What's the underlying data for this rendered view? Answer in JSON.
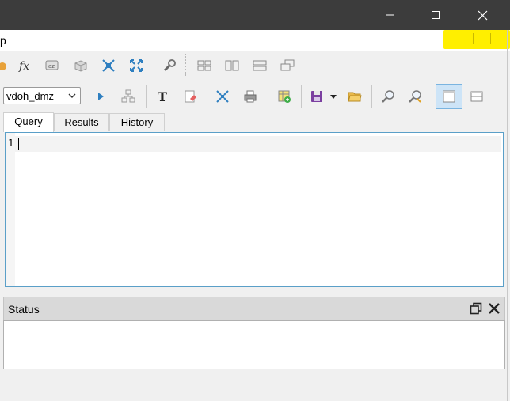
{
  "window": {
    "controls": {
      "minimize": "minimize-icon",
      "maximize": "maximize-icon",
      "close": "close-icon"
    }
  },
  "menubar": {
    "partial_label": "p"
  },
  "toolbar_top": {
    "icons": [
      "star-icon",
      "function-icon",
      "sort-icon",
      "table-icon",
      "collapse-icon",
      "expand-icon",
      "wrench-icon",
      "tile-grid-icon",
      "tile-vertical-icon",
      "tile-horizontal-icon",
      "cascade-icon"
    ]
  },
  "toolbar_query": {
    "database": "vdoh_dmz",
    "icons": [
      "execute-icon",
      "explain-icon",
      "text-format-icon",
      "eraser-icon",
      "expand-all-icon",
      "print-icon",
      "add-table-icon",
      "save-icon",
      "dropdown-arrow-icon",
      "open-folder-icon",
      "find-icon",
      "find-next-icon",
      "split-vertical-icon",
      "split-horizontal-icon"
    ]
  },
  "tabs": [
    "Query",
    "Results",
    "History"
  ],
  "active_tab": "Query",
  "editor": {
    "line_numbers": [
      "1"
    ]
  },
  "status_panel": {
    "title": "Status",
    "icons": [
      "restore-icon",
      "close-panel-icon"
    ]
  },
  "colors": {
    "titlebar": "#3c3c3c",
    "highlight": "#ffef00",
    "editor_border": "#5a9fc8",
    "status_header": "#d9d9d9"
  }
}
